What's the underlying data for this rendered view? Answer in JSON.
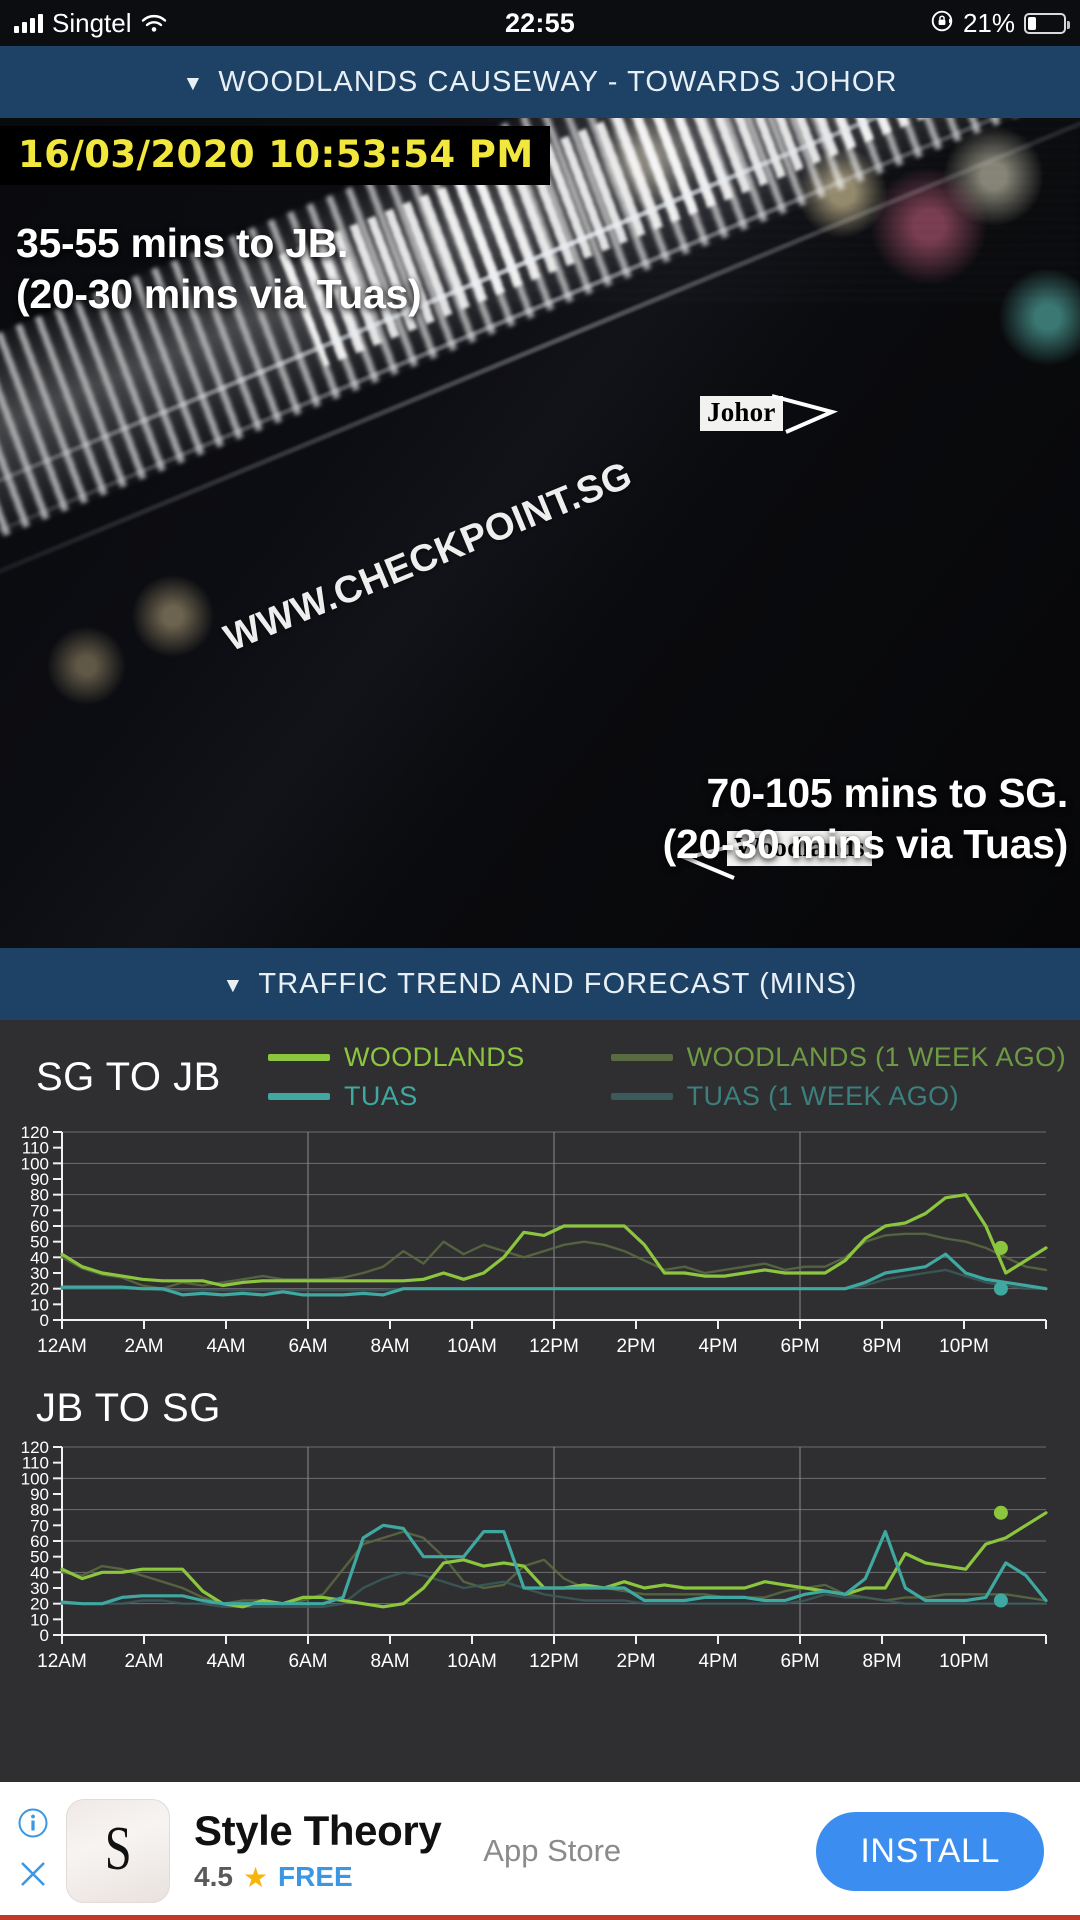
{
  "statusbar": {
    "carrier": "Singtel",
    "time": "22:55",
    "battery_pct": "21%",
    "signal_icon": "signal-bars-icon",
    "wifi_icon": "wifi-icon",
    "lock_icon": "rotation-lock-icon",
    "battery_icon": "battery-icon"
  },
  "camera_section": {
    "header": "WOODLANDS CAUSEWAY - TOWARDS JOHOR",
    "caret": "▼",
    "timestamp": "16/03/2020 10:53:54 PM",
    "overlay_top_line1": "35-55 mins to JB.",
    "overlay_top_line2": "(20-30 mins via Tuas)",
    "overlay_bottom_line1": "70-105 mins to SG.",
    "overlay_bottom_line2": "(20-30 mins via Tuas)",
    "label_johor": "Johor",
    "label_woodlands": "Woodlands",
    "watermark": "WWW.CHECKPOINT.SG"
  },
  "trend_section": {
    "header": "TRAFFIC TREND AND FORECAST (MINS)",
    "caret": "▼",
    "legend": [
      {
        "label": "WOODLANDS",
        "color": "#8cc63f"
      },
      {
        "label": "WOODLANDS (1 WEEK AGO)",
        "color": "#5a6b43"
      },
      {
        "label": "TUAS",
        "color": "#3fa8a0"
      },
      {
        "label": "TUAS (1 WEEK AGO)",
        "color": "#3b5a5c"
      }
    ]
  },
  "colors": {
    "header_bar": "#1d4266",
    "chart_bg": "#333335",
    "woodlands": "#8cc63f",
    "woodlands_prev": "#5a6b43",
    "tuas": "#3fa8a0",
    "tuas_prev": "#3b5a5c",
    "timestamp_text": "#f2e73c",
    "install_button": "#3b8ef0"
  },
  "chart_data": [
    {
      "type": "line",
      "title": "SG TO JB",
      "xlabel": "",
      "ylabel": "MINS",
      "ylim": [
        0,
        120
      ],
      "yticks": [
        0,
        10,
        20,
        30,
        40,
        50,
        60,
        70,
        80,
        90,
        100,
        110,
        120
      ],
      "xticks": [
        "12AM",
        "2AM",
        "4AM",
        "6AM",
        "8AM",
        "10AM",
        "12PM",
        "2PM",
        "4PM",
        "6PM",
        "8PM",
        "10PM"
      ],
      "x": [
        0,
        0.5,
        1,
        1.5,
        2,
        2.5,
        3,
        3.5,
        4,
        4.5,
        5,
        5.5,
        6,
        6.5,
        7,
        7.5,
        8,
        8.5,
        9,
        9.5,
        10,
        10.5,
        11,
        11.5,
        12,
        12.5,
        13,
        13.5,
        14,
        14.5,
        15,
        15.5,
        16,
        16.5,
        17,
        17.5,
        18,
        18.5,
        19,
        19.5,
        20,
        20.5,
        21,
        21.5,
        22,
        22.5,
        22.9
      ],
      "grid": true,
      "legend_position": "top",
      "current_marker": {
        "x": 22.9,
        "woodlands": 46,
        "tuas": 20
      },
      "series": [
        {
          "name": "WOODLANDS",
          "color": "#8cc63f",
          "values": [
            42,
            34,
            30,
            28,
            26,
            25,
            25,
            25,
            22,
            24,
            25,
            25,
            25,
            25,
            25,
            25,
            25,
            25,
            26,
            30,
            26,
            30,
            40,
            56,
            54,
            60,
            60,
            60,
            60,
            48,
            30,
            30,
            28,
            28,
            30,
            32,
            30,
            30,
            30,
            38,
            52,
            60,
            62,
            68,
            78,
            80,
            60,
            30,
            38,
            46
          ]
        },
        {
          "name": "WOODLANDS (1 WEEK AGO)",
          "color": "#5a6b43",
          "values": [
            40,
            33,
            29,
            27,
            22,
            20,
            24,
            22,
            24,
            26,
            28,
            26,
            26,
            26,
            27,
            30,
            34,
            44,
            36,
            50,
            42,
            48,
            44,
            40,
            44,
            48,
            50,
            48,
            44,
            38,
            32,
            34,
            30,
            32,
            34,
            36,
            32,
            34,
            34,
            40,
            50,
            54,
            55,
            55,
            52,
            50,
            46,
            40,
            34,
            32
          ]
        },
        {
          "name": "TUAS",
          "color": "#3fa8a0",
          "values": [
            21,
            21,
            21,
            21,
            20,
            20,
            16,
            17,
            16,
            17,
            16,
            18,
            16,
            16,
            16,
            17,
            16,
            20,
            20,
            20,
            20,
            20,
            20,
            20,
            20,
            20,
            20,
            20,
            20,
            20,
            20,
            20,
            20,
            20,
            20,
            20,
            20,
            20,
            20,
            20,
            24,
            30,
            32,
            34,
            42,
            30,
            26,
            24,
            22,
            20
          ]
        },
        {
          "name": "TUAS (1 WEEK AGO)",
          "color": "#3b5a5c",
          "values": [
            20,
            20,
            20,
            20,
            20,
            19,
            19,
            19,
            19,
            19,
            19,
            19,
            19,
            19,
            19,
            19,
            19,
            20,
            20,
            20,
            20,
            20,
            20,
            20,
            20,
            20,
            20,
            20,
            20,
            20,
            20,
            20,
            20,
            20,
            20,
            20,
            20,
            20,
            20,
            20,
            22,
            26,
            28,
            30,
            32,
            28,
            24,
            22,
            20,
            20
          ]
        }
      ]
    },
    {
      "type": "line",
      "title": "JB TO SG",
      "xlabel": "",
      "ylabel": "MINS",
      "ylim": [
        0,
        120
      ],
      "yticks": [
        0,
        10,
        20,
        30,
        40,
        50,
        60,
        70,
        80,
        90,
        100,
        110,
        120
      ],
      "xticks": [
        "12AM",
        "2AM",
        "4AM",
        "6AM",
        "8AM",
        "10AM",
        "12PM",
        "2PM",
        "4PM",
        "6PM",
        "8PM",
        "10PM"
      ],
      "grid": true,
      "legend_position": "top",
      "current_marker": {
        "x": 22.9,
        "woodlands": 78,
        "tuas": 22
      },
      "series": [
        {
          "name": "WOODLANDS",
          "color": "#8cc63f",
          "values": [
            42,
            36,
            40,
            40,
            42,
            42,
            42,
            28,
            20,
            18,
            22,
            20,
            24,
            24,
            22,
            20,
            18,
            20,
            30,
            46,
            48,
            44,
            46,
            44,
            30,
            30,
            32,
            30,
            34,
            30,
            32,
            30,
            30,
            30,
            30,
            34,
            32,
            30,
            28,
            26,
            30,
            30,
            52,
            46,
            44,
            42,
            58,
            62,
            70,
            78
          ]
        },
        {
          "name": "WOODLANDS (1 WEEK AGO)",
          "color": "#5a6b43",
          "values": [
            40,
            38,
            44,
            42,
            38,
            34,
            30,
            24,
            20,
            22,
            22,
            20,
            22,
            26,
            42,
            58,
            62,
            66,
            62,
            50,
            34,
            30,
            32,
            44,
            48,
            36,
            30,
            30,
            28,
            26,
            26,
            26,
            26,
            24,
            24,
            24,
            28,
            30,
            32,
            26,
            24,
            22,
            24,
            24,
            26,
            26,
            26,
            26,
            24,
            22
          ]
        },
        {
          "name": "TUAS",
          "color": "#3fa8a0",
          "values": [
            21,
            20,
            20,
            24,
            25,
            25,
            25,
            22,
            20,
            20,
            20,
            20,
            20,
            20,
            24,
            62,
            70,
            68,
            50,
            50,
            50,
            66,
            66,
            30,
            30,
            30,
            30,
            30,
            30,
            22,
            22,
            22,
            24,
            24,
            24,
            22,
            22,
            26,
            28,
            26,
            36,
            66,
            30,
            22,
            22,
            22,
            24,
            46,
            38,
            22
          ]
        },
        {
          "name": "TUAS (1 WEEK AGO)",
          "color": "#3b5a5c",
          "values": [
            20,
            20,
            20,
            20,
            22,
            22,
            20,
            20,
            18,
            18,
            18,
            18,
            18,
            18,
            20,
            30,
            36,
            40,
            38,
            34,
            30,
            32,
            34,
            30,
            26,
            24,
            22,
            22,
            22,
            20,
            20,
            20,
            20,
            20,
            20,
            20,
            20,
            22,
            26,
            24,
            24,
            22,
            20,
            20,
            20,
            20,
            20,
            20,
            20,
            20
          ]
        }
      ]
    }
  ],
  "ad": {
    "icon_letter": "S",
    "title": "Style Theory",
    "rating": "4.5",
    "star": "★",
    "price": "FREE",
    "store": "App Store",
    "install_label": "INSTALL",
    "info_icon": "info-icon",
    "close_icon": "close-icon"
  }
}
